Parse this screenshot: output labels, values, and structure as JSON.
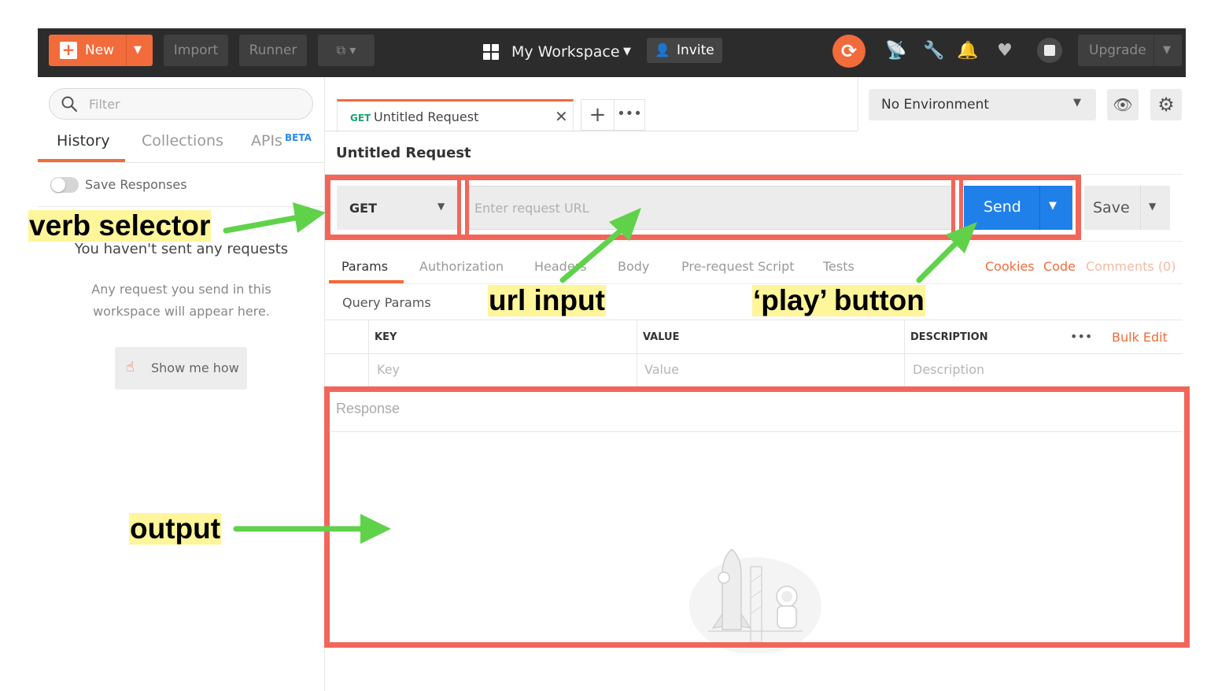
{
  "topbar": {
    "new_label": "New",
    "import_label": "Import",
    "runner_label": "Runner",
    "workspace_label": "My Workspace",
    "invite_label": "Invite",
    "upgrade_label": "Upgrade",
    "icons": [
      "satellite-icon",
      "wrench-icon",
      "bell-icon",
      "heart-icon",
      "chip-icon"
    ]
  },
  "sidebar": {
    "filter_placeholder": "Filter",
    "tabs": [
      {
        "label": "History"
      },
      {
        "label": "Collections"
      },
      {
        "label": "APIs"
      }
    ],
    "beta_badge": "BETA",
    "save_responses_label": "Save Responses",
    "empty_title": "You haven't sent any requests",
    "empty_body": "Any request you send in this workspace will appear here.",
    "show_me_label": "Show me how"
  },
  "request": {
    "tab_method": "GET",
    "tab_name": "Untitled Request",
    "title": "Untitled Request",
    "method": "GET",
    "url_placeholder": "Enter request URL",
    "send_label": "Send",
    "save_label": "Save"
  },
  "environment": {
    "selected": "No Environment"
  },
  "params": {
    "tabs": [
      {
        "label": "Params"
      },
      {
        "label": "Authorization"
      },
      {
        "label": "Headers"
      },
      {
        "label": "Body"
      },
      {
        "label": "Pre-request Script"
      },
      {
        "label": "Tests"
      }
    ],
    "links": {
      "cookies": "Cookies",
      "code": "Code",
      "comments": "Comments (0)"
    },
    "section_title": "Query Params",
    "columns": {
      "key": "KEY",
      "value": "VALUE",
      "description": "DESCRIPTION"
    },
    "bulk_edit": "Bulk Edit",
    "placeholders": {
      "key": "Key",
      "value": "Value",
      "description": "Description"
    }
  },
  "response": {
    "label": "Response"
  },
  "annotations": {
    "verb_selector": "verb selector",
    "url_input": "url  input",
    "play_button": "‘play’ button",
    "output": "output"
  },
  "colors": {
    "brand_orange": "#f26b3a",
    "send_blue": "#1f80ea",
    "highlight_red": "#f2665a",
    "arrow_green": "#5fd24a",
    "callout_yellow": "#fff59a"
  }
}
